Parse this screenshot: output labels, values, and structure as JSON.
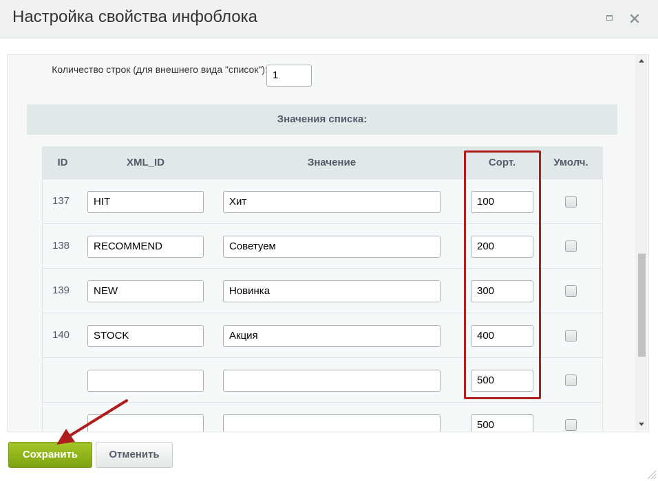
{
  "dialog": {
    "title": "Настройка свойства инфоблока"
  },
  "form": {
    "row_count_label": "Количество строк (для внешнего вида \"список\"):",
    "row_count_value": "1",
    "section_title": "Значения списка:"
  },
  "table": {
    "headers": {
      "id": "ID",
      "xml_id": "XML_ID",
      "value": "Значение",
      "sort": "Сорт.",
      "default": "Умолч."
    },
    "rows": [
      {
        "id": "137",
        "xml_id": "HIT",
        "value": "Хит",
        "sort": "100",
        "default": false
      },
      {
        "id": "138",
        "xml_id": "RECOMMEND",
        "value": "Советуем",
        "sort": "200",
        "default": false
      },
      {
        "id": "139",
        "xml_id": "NEW",
        "value": "Новинка",
        "sort": "300",
        "default": false
      },
      {
        "id": "140",
        "xml_id": "STOCK",
        "value": "Акция",
        "sort": "400",
        "default": false
      },
      {
        "id": "",
        "xml_id": "",
        "value": "",
        "sort": "500",
        "default": false
      },
      {
        "id": "",
        "xml_id": "",
        "value": "",
        "sort": "500",
        "default": false
      }
    ]
  },
  "buttons": {
    "save": "Сохранить",
    "cancel": "Отменить"
  },
  "colors": {
    "highlight": "#b01d1d",
    "save_button": "#8fb41b",
    "header_bg": "#e0e8ea"
  },
  "icons": {
    "maximize": "maximize-icon",
    "close": "close-icon",
    "arrow": "red-arrow-icon"
  }
}
